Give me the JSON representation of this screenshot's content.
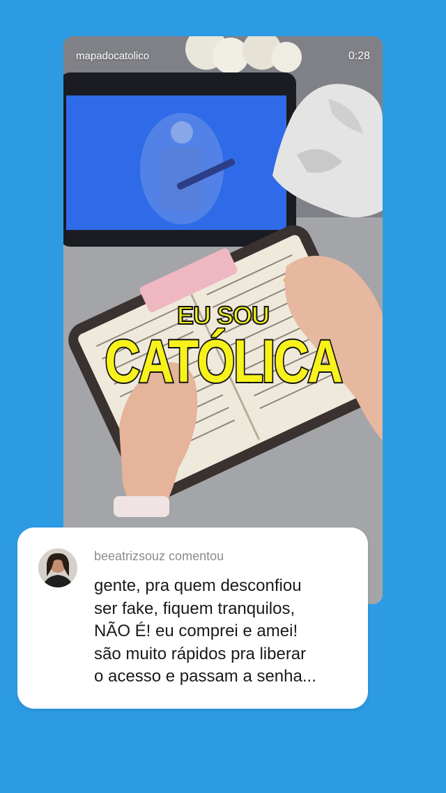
{
  "story": {
    "author": "mapadocatolico",
    "timer": "0:28",
    "caption_small": "EU SOU",
    "caption_big": "CATÓLICA"
  },
  "comment": {
    "header": "beeatrizsouz comentou",
    "lines": [
      "gente, pra quem desconfiou",
      "ser fake, fiquem tranquilos,",
      "NÃO É! eu comprei e amei!",
      "são muito rápidos pra liberar",
      "o acesso e passam a senha..."
    ]
  },
  "colors": {
    "background": "#2d9be3",
    "caption_yellow": "#f7f21c",
    "tablet_screen": "#2f6be8"
  }
}
